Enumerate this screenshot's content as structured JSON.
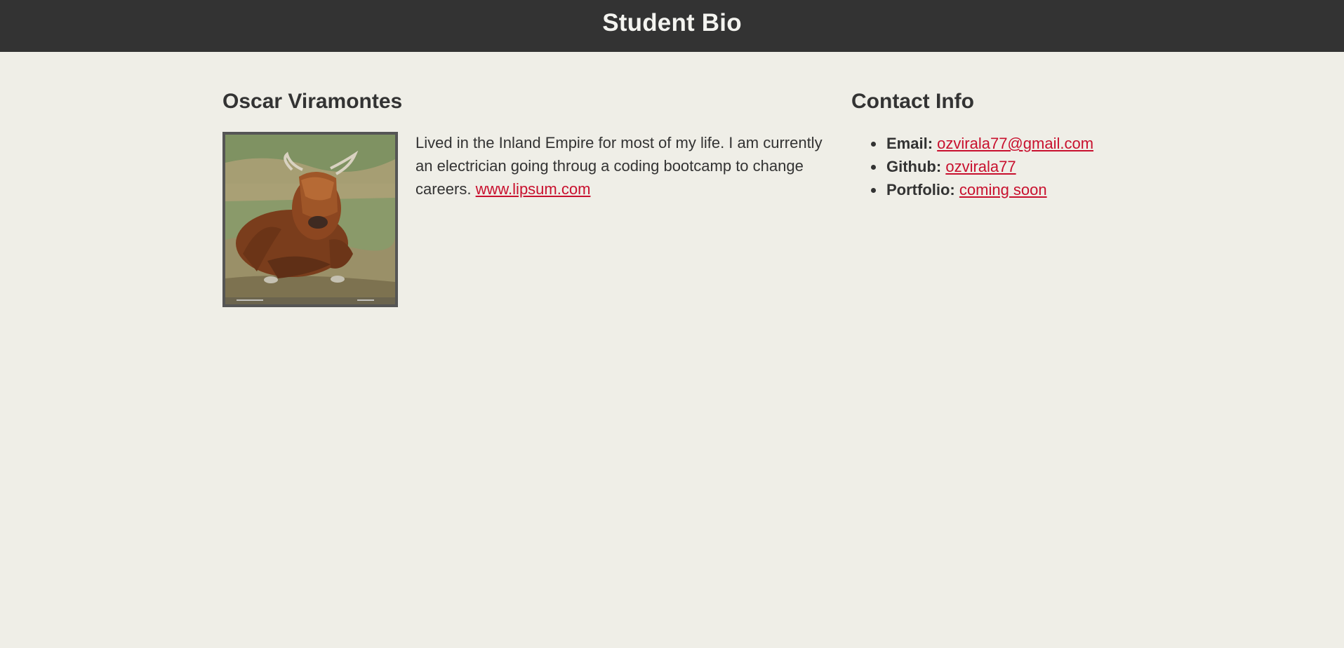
{
  "header": {
    "title": "Student Bio"
  },
  "bio": {
    "name": "Oscar Viramontes",
    "photo_icon": "highland-cow-photo",
    "text": "Lived in the Inland Empire for most of my life. I am currently an electrician going throug a coding bootcamp to change careers.",
    "link_text": "www.lipsum.com"
  },
  "contact": {
    "title": "Contact Info",
    "items": [
      {
        "label": "Email:",
        "value": "ozvirala77@gmail.com"
      },
      {
        "label": "Github:",
        "value": "ozvirala77"
      },
      {
        "label": "Portfolio:",
        "value": "coming soon"
      }
    ]
  },
  "colors": {
    "header_bg": "#333333",
    "page_bg": "#efeee7",
    "link": "#c8102e",
    "text": "#333333"
  }
}
